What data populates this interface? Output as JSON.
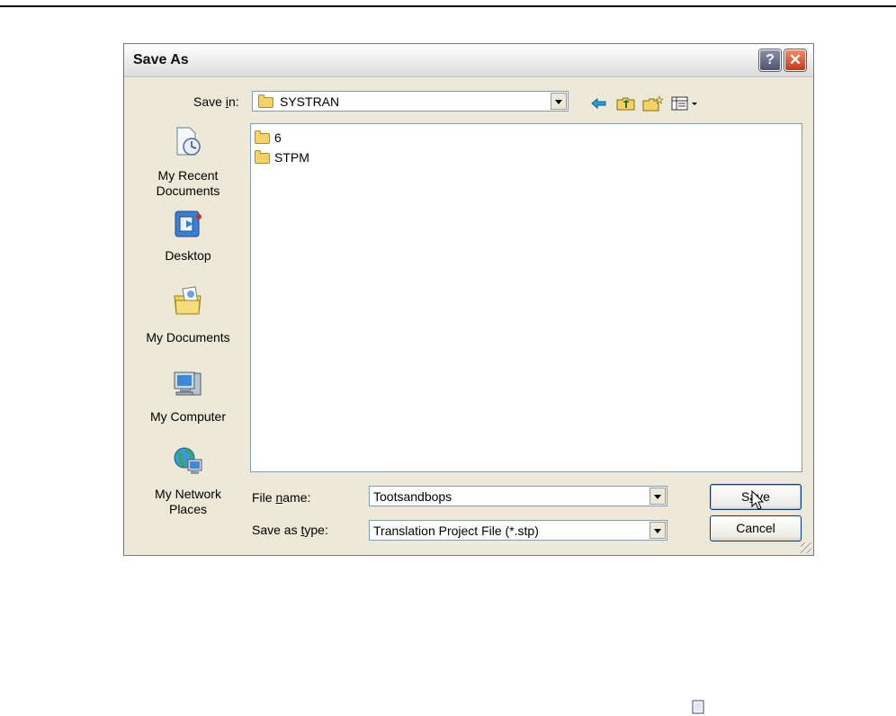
{
  "dialog": {
    "title": "Save As",
    "help_glyph": "?",
    "close_glyph": "✕"
  },
  "save_in": {
    "label_pre": "Save ",
    "label_accel": "i",
    "label_post": "n:",
    "value": "SYSTRAN"
  },
  "toolbar": {
    "icons": [
      "back-arrow-icon",
      "up-folder-icon",
      "new-folder-icon",
      "views-menu-icon"
    ]
  },
  "places": [
    {
      "label_line1": "My Recent",
      "label_line2": "Documents",
      "icon": "recent-documents-icon"
    },
    {
      "label_line1": "Desktop",
      "label_line2": "",
      "icon": "desktop-icon"
    },
    {
      "label_line1": "My Documents",
      "label_line2": "",
      "icon": "my-documents-icon"
    },
    {
      "label_line1": "My Computer",
      "label_line2": "",
      "icon": "my-computer-icon"
    },
    {
      "label_line1": "My Network",
      "label_line2": "Places",
      "icon": "network-places-icon"
    }
  ],
  "files": [
    {
      "name": "6",
      "icon": "folder-icon"
    },
    {
      "name": "STPM",
      "icon": "folder-icon"
    }
  ],
  "file_name": {
    "label_pre": "File ",
    "label_accel": "n",
    "label_post": "ame:",
    "value": "Tootsandbops"
  },
  "save_type": {
    "label_pre": "Save as ",
    "label_accel": "t",
    "label_post": "ype:",
    "value": "Translation Project File (*.stp)"
  },
  "buttons": {
    "save_pre": "S",
    "save_accel": "a",
    "save_post": "ve",
    "cancel": "Cancel"
  },
  "colors": {
    "dialog_bg": "#ece9d8",
    "field_border": "#7f9db9",
    "close_red": "#c03b18",
    "folder_yellow": "#f3d266"
  }
}
